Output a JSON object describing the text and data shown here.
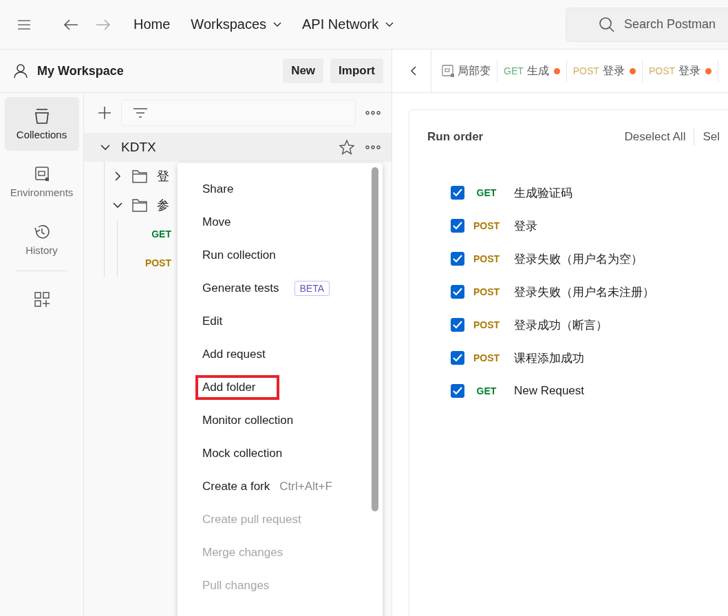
{
  "header": {
    "nav": [
      {
        "label": "Home",
        "dropdown": false
      },
      {
        "label": "Workspaces",
        "dropdown": true
      },
      {
        "label": "API Network",
        "dropdown": true
      }
    ],
    "search": {
      "placeholder": "Search Postman"
    }
  },
  "workspace": {
    "title": "My Workspace",
    "buttons": [
      "New",
      "Import"
    ]
  },
  "sidebar": {
    "items": [
      {
        "label": "Collections",
        "kind": "collections",
        "selected": true
      },
      {
        "label": "Environments",
        "kind": "environments",
        "selected": false
      },
      {
        "label": "History",
        "kind": "history",
        "selected": false
      }
    ]
  },
  "tree": {
    "collection": {
      "name": "KDTX",
      "expanded": true
    },
    "children": [
      {
        "name": "登",
        "kind": "folder",
        "expanded": false
      },
      {
        "name": "参",
        "kind": "folder",
        "expanded": true,
        "children": [
          {
            "method": "GET",
            "kind": "request"
          },
          {
            "method": "POST",
            "kind": "request"
          }
        ]
      }
    ]
  },
  "tabs": [
    {
      "kind": "env",
      "label": "局部变"
    },
    {
      "kind": "request",
      "method": "GET",
      "label": "生成",
      "unsaved": true
    },
    {
      "kind": "request",
      "method": "POST",
      "label": "登录",
      "unsaved": true
    },
    {
      "kind": "request",
      "method": "POST",
      "label": "登录",
      "unsaved": true
    }
  ],
  "menu": [
    {
      "label": "Share",
      "disabled": false,
      "highlighted": false
    },
    {
      "label": "Move",
      "disabled": false,
      "highlighted": false
    },
    {
      "label": "Run collection",
      "disabled": false,
      "highlighted": false
    },
    {
      "label": "Generate tests",
      "badge": "BETA",
      "disabled": false,
      "highlighted": false
    },
    {
      "label": "Edit",
      "disabled": false,
      "highlighted": false
    },
    {
      "label": "Add request",
      "disabled": false,
      "highlighted": false
    },
    {
      "label": "Add folder",
      "disabled": false,
      "highlighted": true
    },
    {
      "label": "Monitor collection",
      "disabled": false,
      "highlighted": false
    },
    {
      "label": "Mock collection",
      "disabled": false,
      "highlighted": false
    },
    {
      "label": "Create a fork",
      "shortcut": "Ctrl+Alt+F",
      "disabled": false,
      "highlighted": false
    },
    {
      "label": "Create pull request",
      "disabled": true,
      "highlighted": false
    },
    {
      "label": "Merge changes",
      "disabled": true,
      "highlighted": false
    },
    {
      "label": "Pull changes",
      "disabled": true,
      "highlighted": false
    }
  ],
  "run_order": {
    "title": "Run order",
    "actions": [
      "Deselect All",
      "Sel"
    ],
    "requests": [
      {
        "method": "GET",
        "name": "生成验证码",
        "checked": true
      },
      {
        "method": "POST",
        "name": "登录",
        "checked": true
      },
      {
        "method": "POST",
        "name": "登录失败（用户名为空）",
        "checked": true
      },
      {
        "method": "POST",
        "name": "登录失败（用户名未注册）",
        "checked": true
      },
      {
        "method": "POST",
        "name": "登录成功（断言）",
        "checked": true
      },
      {
        "method": "POST",
        "name": "课程添加成功",
        "checked": true
      },
      {
        "method": "GET",
        "name": "New Request",
        "checked": true
      }
    ]
  }
}
